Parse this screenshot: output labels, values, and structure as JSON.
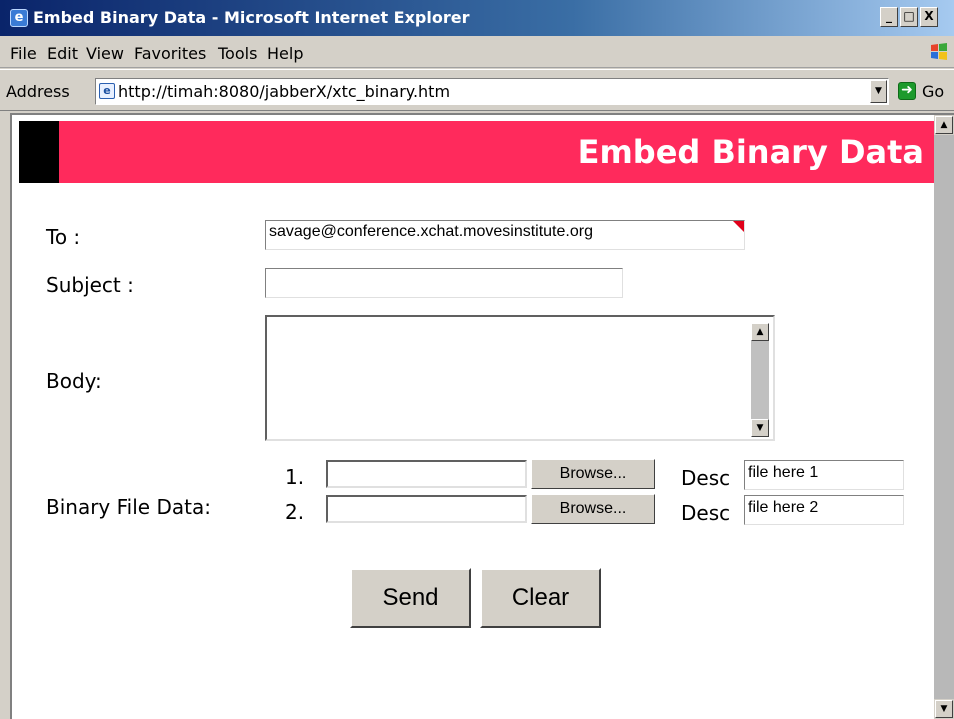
{
  "window": {
    "title": "Embed Binary Data - Microsoft Internet Explorer",
    "controls": [
      "_",
      "□",
      "X"
    ]
  },
  "menu": {
    "items": [
      "File",
      "Edit",
      "View",
      "Favorites",
      "Tools",
      "Help"
    ]
  },
  "address_bar": {
    "label": "Address",
    "url": "http://timah:8080/jabberX/xtc_binary.htm",
    "go_label": "Go"
  },
  "banner": {
    "title": "Embed Binary Data",
    "color": "#ff2a5c"
  },
  "form": {
    "to_label": "To :",
    "to_value": "savage@conference.xchat.movesinstitute.org",
    "subject_label": "Subject :",
    "subject_value": "",
    "body_label": "Body:",
    "body_value": "",
    "binary_label": "Binary File Data:",
    "files": [
      {
        "number": "1.",
        "path": "",
        "browse_label": "Browse...",
        "desc_label": "Desc",
        "desc_value": "file here 1"
      },
      {
        "number": "2.",
        "path": "",
        "browse_label": "Browse...",
        "desc_label": "Desc",
        "desc_value": "file here 2"
      }
    ],
    "send_label": "Send",
    "clear_label": "Clear"
  }
}
